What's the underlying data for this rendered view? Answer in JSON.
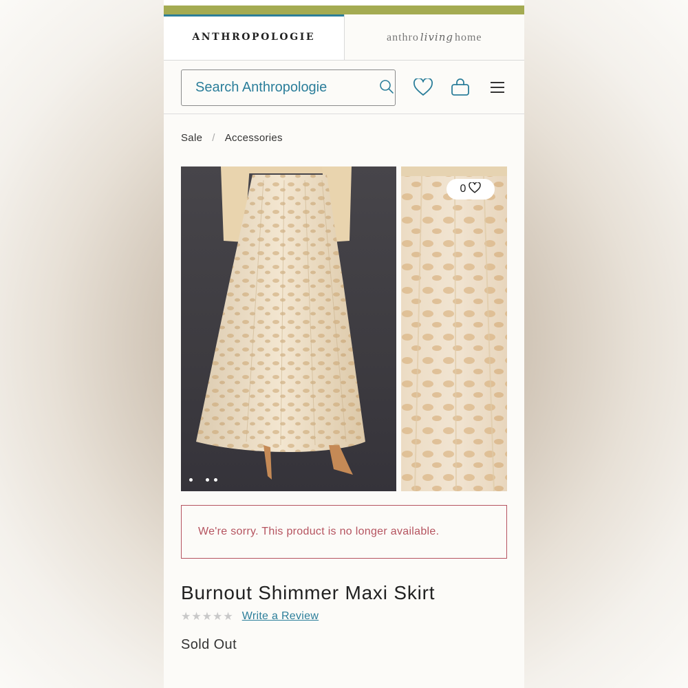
{
  "brand_tabs": [
    {
      "label": "ANTHROPOLOGIE"
    },
    {
      "label_pre": "anthro",
      "label_script": "living",
      "label_post": "home"
    }
  ],
  "search": {
    "placeholder": "Search Anthropologie"
  },
  "breadcrumb": {
    "items": [
      "Sale",
      "Accessories"
    ],
    "separator": "/"
  },
  "gallery": {
    "like_count": "0",
    "active_dot": 1,
    "dot_count": 3
  },
  "notice": {
    "message": "We're sorry. This product is no longer available."
  },
  "product": {
    "title": "Burnout Shimmer Maxi Skirt",
    "rating_stars": "★★★★★",
    "rating_fraction": 0,
    "review_link": "Write a Review",
    "stock_status": "Sold Out"
  },
  "colors": {
    "accent": "#2b7e9a",
    "olive_bar": "#a4ab52",
    "alert": "#b5535f"
  }
}
